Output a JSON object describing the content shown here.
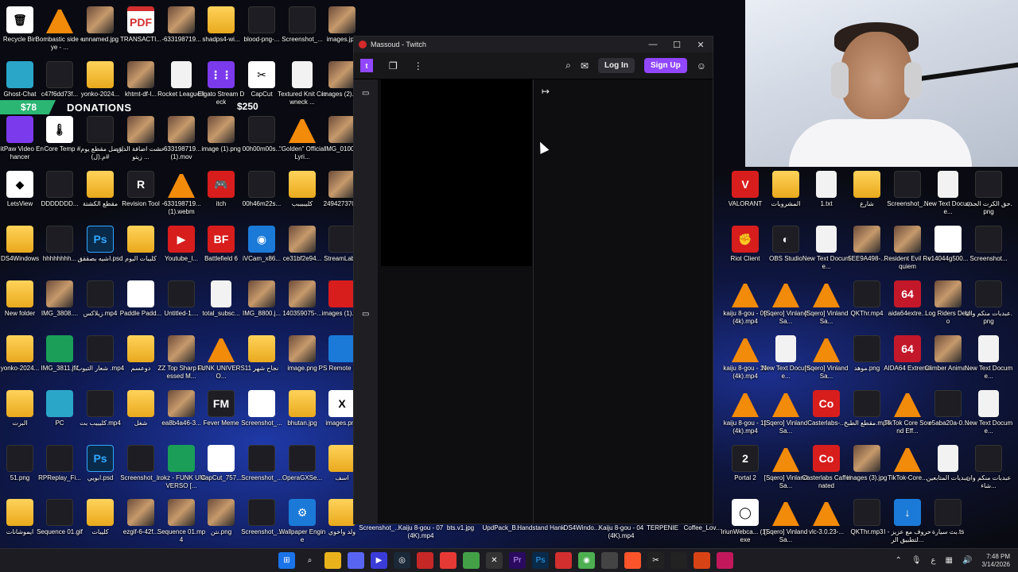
{
  "desktop": {
    "icons": [
      {
        "label": "Recycle Bin",
        "glyph": "🗑",
        "style": "g-white"
      },
      {
        "label": "Bombastic side eye - ...",
        "glyph": "",
        "style": "g-vlc"
      },
      {
        "label": "unnamed.jpg",
        "glyph": "",
        "style": "g-img"
      },
      {
        "label": "TRANSACTI...",
        "glyph": "PDF",
        "style": "g-pdf"
      },
      {
        "label": "-633198719...",
        "glyph": "",
        "style": "g-img"
      },
      {
        "label": "shadps4-wi...",
        "glyph": "",
        "style": "g-folder"
      },
      {
        "label": "blood-png-...",
        "glyph": "",
        "style": "g-dark"
      },
      {
        "label": "Screenshot_...",
        "glyph": "",
        "style": "g-dark"
      },
      {
        "label": "images.jpg",
        "glyph": "",
        "style": "g-img"
      },
      {
        "label": "Ghost-Chat",
        "glyph": "",
        "style": "g-teal"
      },
      {
        "label": "c47f6dd73f...",
        "glyph": "",
        "style": "g-dark"
      },
      {
        "label": "yonko-2024...",
        "glyph": "",
        "style": "g-folder"
      },
      {
        "label": "khtmt-df-l...",
        "glyph": "",
        "style": "g-img"
      },
      {
        "label": "Rocket League®",
        "glyph": "",
        "style": "g-file"
      },
      {
        "label": "Elgato Stream Deck",
        "glyph": "⋮⋮",
        "style": "g-purple"
      },
      {
        "label": "CapCut",
        "glyph": "✂",
        "style": "g-white"
      },
      {
        "label": "Textured Knit Crewneck ...",
        "glyph": "",
        "style": "g-file"
      },
      {
        "label": "images (2).jpg",
        "glyph": "",
        "style": "g-img"
      },
      {
        "label": "HitPaw Video Enhancer",
        "glyph": "",
        "style": "g-purple"
      },
      {
        "label": "Core Temp",
        "glyph": "🌡",
        "style": "g-white"
      },
      {
        "label": "#افضل مقطع يوم م.(ل)#",
        "glyph": "",
        "style": "g-dark"
      },
      {
        "label": "خشت اضافة الدين زيتو ...",
        "glyph": "",
        "style": "g-img"
      },
      {
        "label": "-633198719... (1).mov",
        "glyph": "",
        "style": "g-img"
      },
      {
        "label": "image (1).png",
        "glyph": "",
        "style": "g-img"
      },
      {
        "label": "00h00m00s...",
        "glyph": "",
        "style": "g-dark"
      },
      {
        "label": "\"Golden\" Official Lyri...",
        "glyph": "",
        "style": "g-vlc"
      },
      {
        "label": "IMG_0100...",
        "glyph": "",
        "style": "g-img"
      },
      {
        "label": "LetsView",
        "glyph": "◆",
        "style": "g-white"
      },
      {
        "label": "DDDDDDD...",
        "glyph": "",
        "style": "g-dark"
      },
      {
        "label": "مقطع الكشتة",
        "glyph": "",
        "style": "g-folder"
      },
      {
        "label": "Revision Tool",
        "glyph": "R",
        "style": "g-dark"
      },
      {
        "label": "-633198719... (1).webm",
        "glyph": "",
        "style": "g-vlc"
      },
      {
        "label": "itch",
        "glyph": "🎮",
        "style": "g-red"
      },
      {
        "label": "00h46m22s...",
        "glyph": "",
        "style": "g-dark"
      },
      {
        "label": "كليببببب",
        "glyph": "",
        "style": "g-folder"
      },
      {
        "label": "249427370...",
        "glyph": "",
        "style": "g-img"
      },
      {
        "label": "DS4Windows",
        "glyph": "",
        "style": "g-folder"
      },
      {
        "label": "hhhhhhhh...",
        "glyph": "",
        "style": "g-dark"
      },
      {
        "label": "اشيه بصققق.psd",
        "glyph": "Ps",
        "style": "g-ps"
      },
      {
        "label": "كليبات اليوم",
        "glyph": "",
        "style": "g-folder"
      },
      {
        "label": "Youtube_l...",
        "glyph": "▶",
        "style": "g-red"
      },
      {
        "label": "Battlefield 6",
        "glyph": "BF",
        "style": "g-red"
      },
      {
        "label": "iVCam_x86...",
        "glyph": "◉",
        "style": "g-blue"
      },
      {
        "label": "ce31bf2e94...",
        "glyph": "",
        "style": "g-img"
      },
      {
        "label": "StreamLab...",
        "glyph": "",
        "style": "g-dark"
      },
      {
        "label": "New folder",
        "glyph": "",
        "style": "g-folder"
      },
      {
        "label": "IMG_3808....",
        "glyph": "",
        "style": "g-img"
      },
      {
        "label": "زيلاكس.mp4",
        "glyph": "",
        "style": "g-dark"
      },
      {
        "label": "Paddle Padd...",
        "glyph": "",
        "style": "g-white"
      },
      {
        "label": "Untitled-1....",
        "glyph": "",
        "style": "g-dark"
      },
      {
        "label": "total_subsc...",
        "glyph": "",
        "style": "g-file"
      },
      {
        "label": "IMG_8800.j...",
        "glyph": "",
        "style": "g-img"
      },
      {
        "label": "140359075-...",
        "glyph": "",
        "style": "g-img"
      },
      {
        "label": "images (1).jpg",
        "glyph": "",
        "style": "g-red"
      },
      {
        "label": "yonko-2024...",
        "glyph": "",
        "style": "g-folder"
      },
      {
        "label": "IMG_3811.jfif",
        "glyph": "",
        "style": "g-green"
      },
      {
        "label": "شعار التيوب .mp4",
        "glyph": "",
        "style": "g-dark"
      },
      {
        "label": "دوعسم",
        "glyph": "",
        "style": "g-folder"
      },
      {
        "label": "ZZ Top Sharp Dressed M...",
        "glyph": "",
        "style": "g-img"
      },
      {
        "label": "FUNK UNIVERSO...",
        "glyph": "",
        "style": "g-vlc"
      },
      {
        "label": "نجاح شهر 11",
        "glyph": "",
        "style": "g-folder"
      },
      {
        "label": "image.png",
        "glyph": "",
        "style": "g-img"
      },
      {
        "label": "PS Remote Play",
        "glyph": "",
        "style": "g-blue"
      },
      {
        "label": "البرت",
        "glyph": "",
        "style": "g-folder"
      },
      {
        "label": "PC",
        "glyph": "",
        "style": "g-teal"
      },
      {
        "label": "كليبيب بت.mp4",
        "glyph": "",
        "style": "g-dark"
      },
      {
        "label": "شغل",
        "glyph": "",
        "style": "g-folder"
      },
      {
        "label": "ea8b4a46-3...",
        "glyph": "",
        "style": "g-img"
      },
      {
        "label": "Fever Meme",
        "glyph": "FM",
        "style": "g-dark"
      },
      {
        "label": "Screenshot_...",
        "glyph": "",
        "style": "g-white"
      },
      {
        "label": "bhutan.jpg",
        "glyph": "",
        "style": "g-folder"
      },
      {
        "label": "images.png",
        "glyph": "X",
        "style": "g-white"
      },
      {
        "label": "51.png",
        "glyph": "",
        "style": "g-dark"
      },
      {
        "label": "RPReplay_Fi...",
        "glyph": "",
        "style": "g-dark"
      },
      {
        "label": "ابويي.psd",
        "glyph": "Ps",
        "style": "g-ps"
      },
      {
        "label": "Screenshot_...",
        "glyph": "",
        "style": "g-dark"
      },
      {
        "label": "lrokz - FUNK UNIVERSO [...",
        "glyph": "",
        "style": "g-green"
      },
      {
        "label": "CapCut_757...",
        "glyph": "",
        "style": "g-white"
      },
      {
        "label": "Screenshot_...",
        "glyph": "",
        "style": "g-dark"
      },
      {
        "label": "OperaGXSe...",
        "glyph": "",
        "style": "g-dark"
      },
      {
        "label": "اسف",
        "glyph": "",
        "style": "g-folder"
      },
      {
        "label": "ايموشانات",
        "glyph": "",
        "style": "g-folder"
      },
      {
        "label": "Sequence 01.gif",
        "glyph": "",
        "style": "g-dark"
      },
      {
        "label": "كليبات",
        "glyph": "",
        "style": "g-folder"
      },
      {
        "label": "ezgif-6-42f...",
        "glyph": "",
        "style": "g-img"
      },
      {
        "label": "Sequence 01.mp4",
        "glyph": "",
        "style": "g-img"
      },
      {
        "label": "نتن.png",
        "glyph": "",
        "style": "g-img"
      },
      {
        "label": "Screenshot_...",
        "glyph": "",
        "style": "g-dark"
      },
      {
        "label": "Wallpaper Engine",
        "glyph": "⚙",
        "style": "g-blue"
      },
      {
        "label": "ولد واخوي",
        "glyph": "",
        "style": "g-folder"
      }
    ],
    "right_icons": [
      {
        "label": "VALORANT",
        "glyph": "V",
        "style": "g-red"
      },
      {
        "label": "المشروبات",
        "glyph": "",
        "style": "g-folder"
      },
      {
        "label": "1.txt",
        "glyph": "",
        "style": "g-file"
      },
      {
        "label": "شارع",
        "glyph": "",
        "style": "g-folder"
      },
      {
        "label": "Screenshot_...",
        "glyph": "",
        "style": "g-dark"
      },
      {
        "label": "New Text Docume...",
        "glyph": "",
        "style": "g-file"
      },
      {
        "label": "حق الكرت الجديد.png",
        "glyph": "",
        "style": "g-dark"
      },
      {
        "label": "Riot Client",
        "glyph": "✊",
        "style": "g-red"
      },
      {
        "label": "OBS Studio",
        "glyph": "◐",
        "style": "g-dark"
      },
      {
        "label": "New Text Docume...",
        "glyph": "",
        "style": "g-file"
      },
      {
        "label": "5EE9A498-...",
        "glyph": "",
        "style": "g-img"
      },
      {
        "label": "Resident Evil Requiem",
        "glyph": "",
        "style": "g-img"
      },
      {
        "label": "v14044g500...",
        "glyph": "",
        "style": "g-white"
      },
      {
        "label": "Screenshot...",
        "glyph": "",
        "style": "g-dark"
      },
      {
        "label": "kaiju 8-gou - 09 (4k).mp4",
        "glyph": "",
        "style": "g-vlc"
      },
      {
        "label": "[Sqero] Vinland Sa...",
        "glyph": "",
        "style": "g-vlc"
      },
      {
        "label": "[Sqero] Vinland Sa...",
        "glyph": "",
        "style": "g-vlc"
      },
      {
        "label": "QKThr.mp4",
        "glyph": "",
        "style": "g-dark"
      },
      {
        "label": "aida64extre...",
        "glyph": "64",
        "style": "g-64"
      },
      {
        "label": "Log Riders Demo",
        "glyph": "",
        "style": "g-img"
      },
      {
        "label": "عبدبات منكم واليا.png",
        "glyph": "",
        "style": "g-dark"
      },
      {
        "label": "kaiju 8-gou - 10 (4k).mp4",
        "glyph": "",
        "style": "g-vlc"
      },
      {
        "label": "New Text Docume...",
        "glyph": "",
        "style": "g-file"
      },
      {
        "label": "[Sqero] Vinland Sa...",
        "glyph": "",
        "style": "g-vlc"
      },
      {
        "label": "موهد.png",
        "glyph": "",
        "style": "g-dark"
      },
      {
        "label": "AIDA64 Extreme",
        "glyph": "64",
        "style": "g-64"
      },
      {
        "label": "Climber Anima...",
        "glyph": "",
        "style": "g-img"
      },
      {
        "label": "New Text Docume...",
        "glyph": "",
        "style": "g-file"
      },
      {
        "label": "kaiju 8-gou - 11 (4k).mp4",
        "glyph": "",
        "style": "g-vlc"
      },
      {
        "label": "[Sqero] Vinland Sa...",
        "glyph": "",
        "style": "g-vlc"
      },
      {
        "label": "Casterlabs-...",
        "glyph": "Co",
        "style": "g-red"
      },
      {
        "label": "مقطع الطبخ.mp4",
        "glyph": "",
        "style": "g-dark"
      },
      {
        "label": "TikTok Core Sound Eff...",
        "glyph": "",
        "style": "g-vlc"
      },
      {
        "label": "e5aba20a-0...",
        "glyph": "",
        "style": "g-dark"
      },
      {
        "label": "New Text Docume...",
        "glyph": "",
        "style": "g-file"
      },
      {
        "label": "Portal 2",
        "glyph": "2",
        "style": "g-dark"
      },
      {
        "label": "[Sqero] Vinland Sa...",
        "glyph": "",
        "style": "g-vlc"
      },
      {
        "label": "Casterlabs Caffeinated",
        "glyph": "Co",
        "style": "g-red"
      },
      {
        "label": "images (3).jpg",
        "glyph": "",
        "style": "g-img"
      },
      {
        "label": "TikTok-Core...",
        "glyph": "",
        "style": "g-vlc"
      },
      {
        "label": "عبديات المتابعين",
        "glyph": "",
        "style": "g-file"
      },
      {
        "label": "عبدبات منكم وان شاء...",
        "glyph": "",
        "style": "g-dark"
      },
      {
        "label": "IriunWebca... (1).exe",
        "glyph": "◯",
        "style": "g-white"
      },
      {
        "label": "[Sqero] Vinland Sa...",
        "glyph": "",
        "style": "g-vlc"
      },
      {
        "label": "vlc-3.0.23-...",
        "glyph": "",
        "style": "g-vlc"
      },
      {
        "label": "QKThr.mp3",
        "glyph": "",
        "style": "g-dark"
      },
      {
        "label": "حروف مع عزيز - التطبيق الر...",
        "glyph": "↓",
        "style": "g-blue"
      },
      {
        "label": "بث سيارة.ts",
        "glyph": "",
        "style": "g-dark"
      }
    ],
    "bottom_overlay_labels": [
      "Screenshot_...",
      "Kaiju 8-gou - 07 (4K).mp4",
      "bts.v1.jpg",
      "UpdPack_B...",
      "Handstand Hank",
      "DS4Windo...",
      "Kaiju 8-gou - 04 (4K).mp4",
      "TERPENIE",
      "Coffee_Lov..."
    ]
  },
  "donations": {
    "amount_1": "$78",
    "title": "DONATIONS",
    "amount_2": "$250"
  },
  "twitch": {
    "window_title": "Massoud - Twitch",
    "controls": {
      "minimize": "—",
      "maximize": "☐",
      "close": "✕"
    },
    "login_label": "Log In",
    "signup_label": "Sign Up"
  },
  "taskbar": {
    "time": "7:48 PM",
    "date": "3/14/2026",
    "lang": "ع"
  }
}
